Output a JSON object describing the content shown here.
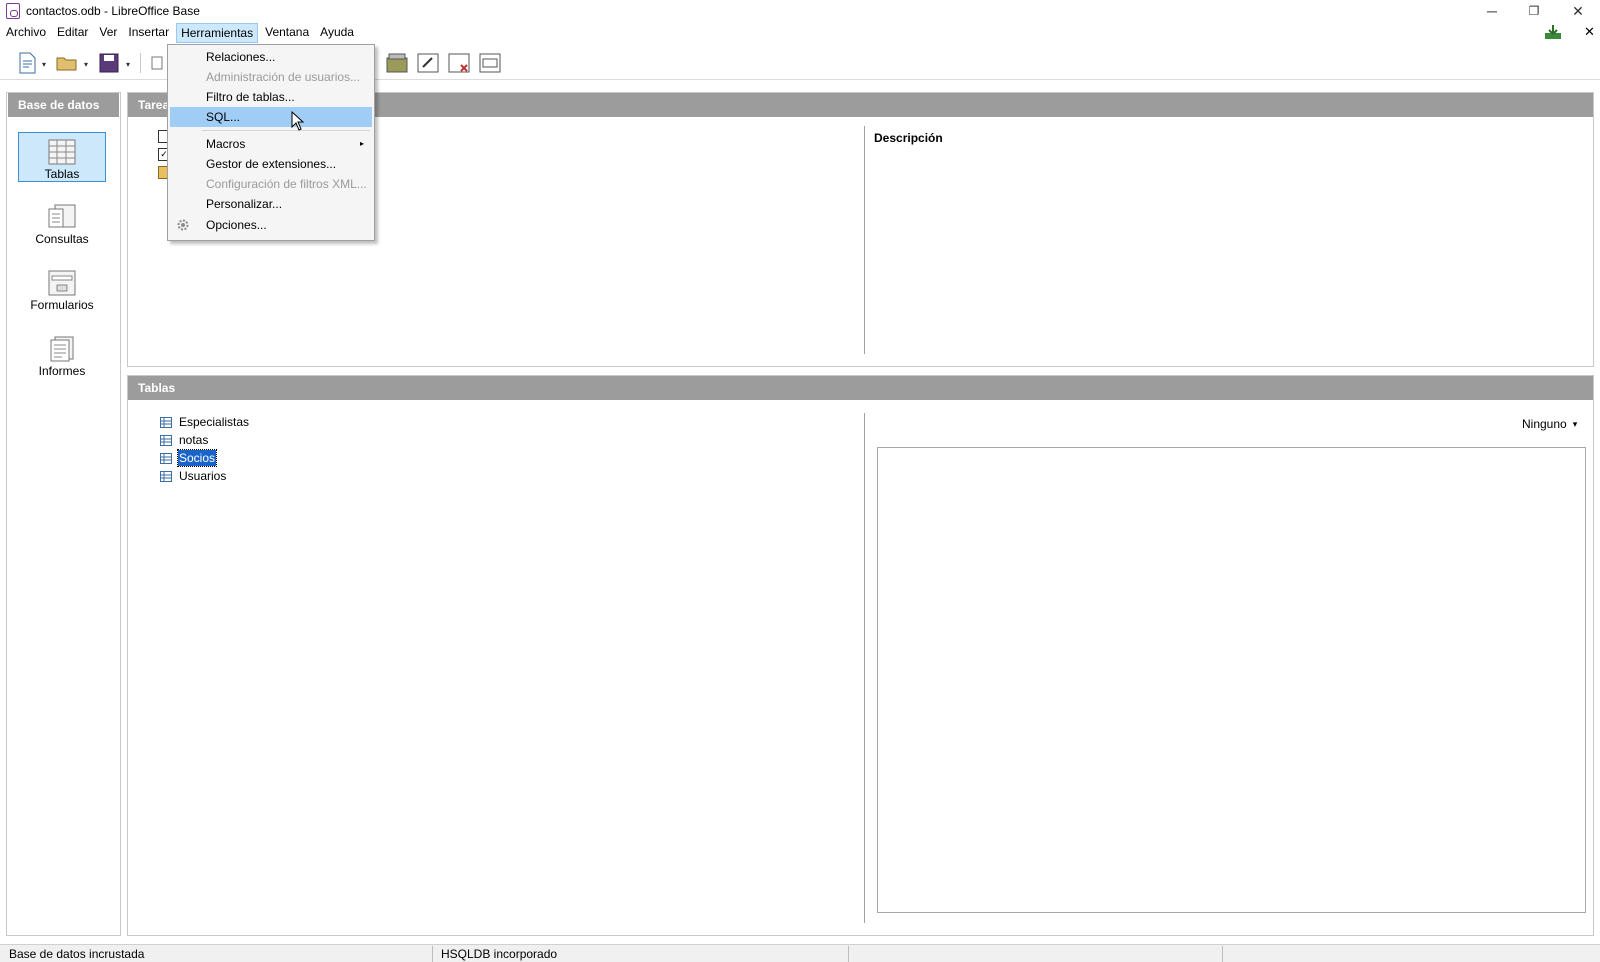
{
  "window": {
    "title": "contactos.odb - LibreOffice Base",
    "minimize": "─",
    "restore": "❐",
    "close": "✕"
  },
  "menubar": {
    "items": [
      "Archivo",
      "Editar",
      "Ver",
      "Insertar",
      "Herramientas",
      "Ventana",
      "Ayuda"
    ],
    "active_index": 4,
    "close_doc": "✕"
  },
  "dropdown": {
    "items": [
      {
        "label": "Relaciones...",
        "enabled": true
      },
      {
        "label": "Administración de usuarios...",
        "enabled": false
      },
      {
        "label": "Filtro de tablas...",
        "enabled": true
      },
      {
        "label": "SQL...",
        "enabled": true,
        "highlighted": true
      },
      {
        "label": "Macros",
        "enabled": true,
        "submenu": true
      },
      {
        "label": "Gestor de extensiones...",
        "enabled": true
      },
      {
        "label": "Configuración de filtros XML...",
        "enabled": false
      },
      {
        "label": "Personalizar...",
        "enabled": true
      },
      {
        "label": "Opciones...",
        "enabled": true
      }
    ],
    "submenu_arrow": "▸"
  },
  "sidebar": {
    "header": "Base de datos",
    "items": [
      {
        "label": "Tablas",
        "selected": true
      },
      {
        "label": "Consultas",
        "selected": false
      },
      {
        "label": "Formularios",
        "selected": false
      },
      {
        "label": "Informes",
        "selected": false
      }
    ]
  },
  "tasks_panel": {
    "header": "Tarea",
    "description_label": "Descripción"
  },
  "tables_panel": {
    "header": "Tablas",
    "tables": [
      "Especialistas",
      "notas",
      "Socios",
      "Usuarios"
    ],
    "selected_index": 2,
    "preview_mode": "Ninguno",
    "preview_arrow": "▾"
  },
  "statusbar": {
    "left": "Base de datos incrustada",
    "middle": "HSQLDB incorporado"
  },
  "colors": {
    "accent": "#1a64c8",
    "panel_header": "#9c9c9c",
    "selection": "#cde8fb",
    "menu_highlight": "#9fcdf5"
  }
}
